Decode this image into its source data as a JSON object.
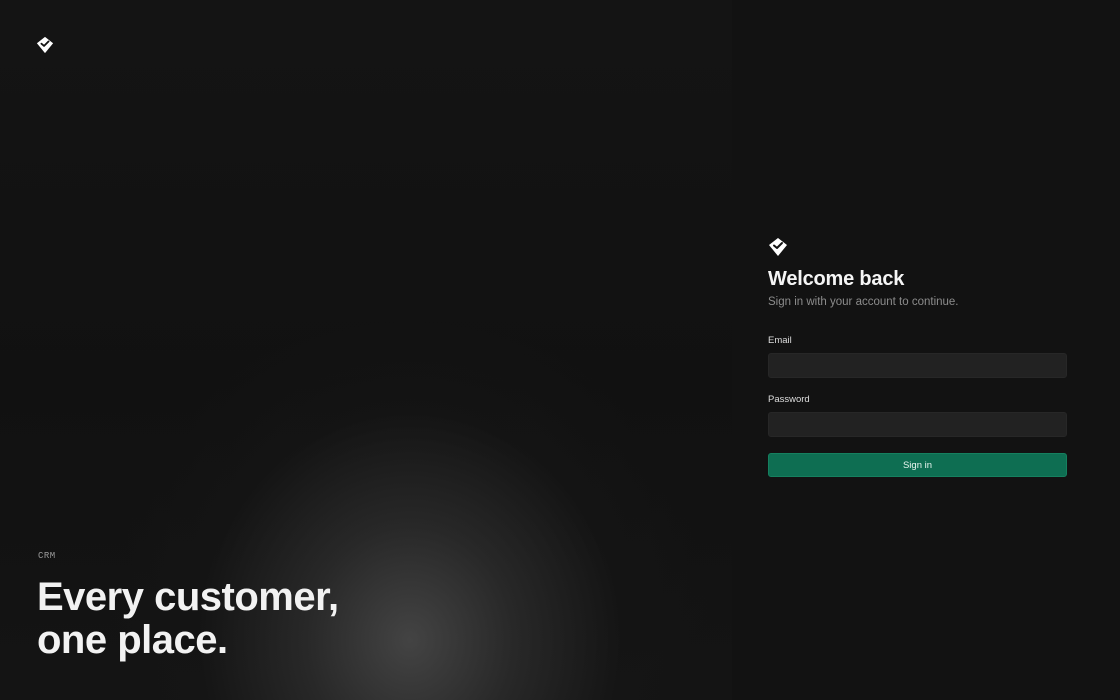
{
  "hero": {
    "eyebrow": "CRM",
    "headline_line1": "Every customer,",
    "headline_line2": "one place."
  },
  "brand": {
    "logo_icon": "diamond-check-logo"
  },
  "signin": {
    "title": "Welcome back",
    "subtitle": "Sign in with your account to continue.",
    "email_label": "Email",
    "email_value": "",
    "password_label": "Password",
    "password_value": "",
    "button_label": "Sign in"
  },
  "colors": {
    "background": "#121212",
    "input_background": "#222222",
    "accent": "#0e6e52"
  }
}
